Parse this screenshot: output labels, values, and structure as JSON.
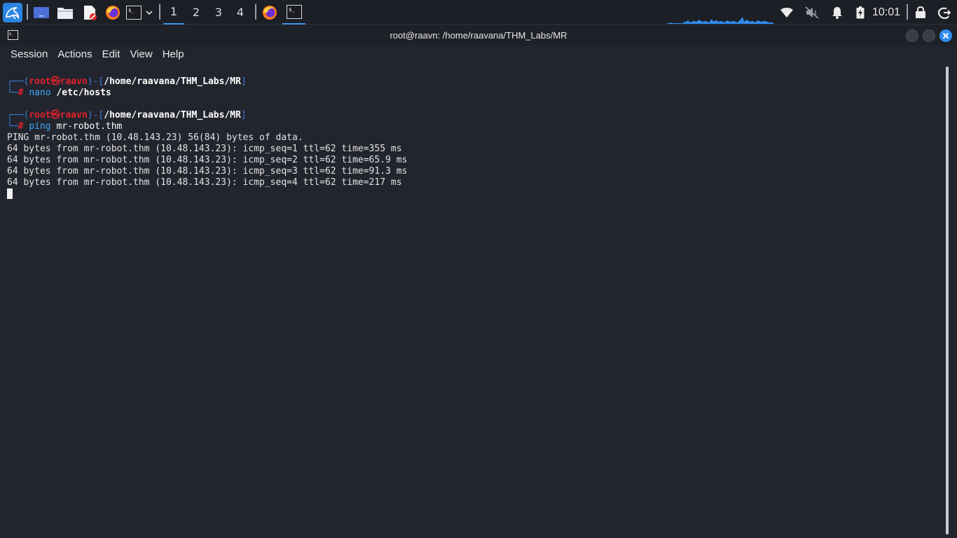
{
  "panel": {
    "workspaces": [
      "1",
      "2",
      "3",
      "4"
    ],
    "active_workspace": "1",
    "clock": "10:01",
    "icons": {
      "menu": "kali-dragon-icon",
      "desktop": "show-desktop-icon",
      "files": "file-manager-icon",
      "editor": "text-editor-icon",
      "browser": "firefox-icon",
      "terminal": "terminal-icon",
      "network": "wifi-icon",
      "volume": "volume-muted-icon",
      "notifications": "bell-icon",
      "battery": "battery-charging-icon",
      "lock": "lock-icon",
      "logout": "logout-icon"
    },
    "colors": {
      "accent": "#3d8fe6",
      "graph": "#2f8cf0"
    }
  },
  "window": {
    "title": "root@raavn: /home/raavana/THM_Labs/MR",
    "menu": [
      "Session",
      "Actions",
      "Edit",
      "View",
      "Help"
    ]
  },
  "terminal": {
    "prompt": {
      "open": "┌──(",
      "user": "root",
      "at": "㉿",
      "host": "raavn",
      "mid": ")-[",
      "path": "/home/raavana/THM_Labs/MR",
      "close": "]",
      "corner": "└─",
      "hash": "#"
    },
    "commands": [
      {
        "cmd": "nano",
        "arg": "/etc/hosts"
      },
      {
        "cmd": "ping",
        "arg": "mr-robot.thm"
      }
    ],
    "output": [
      "PING mr-robot.thm (10.48.143.23) 56(84) bytes of data.",
      "64 bytes from mr-robot.thm (10.48.143.23): icmp_seq=1 ttl=62 time=355 ms",
      "64 bytes from mr-robot.thm (10.48.143.23): icmp_seq=2 ttl=62 time=65.9 ms",
      "64 bytes from mr-robot.thm (10.48.143.23): icmp_seq=3 ttl=62 time=91.3 ms",
      "64 bytes from mr-robot.thm (10.48.143.23): icmp_seq=4 ttl=62 time=217 ms"
    ]
  }
}
